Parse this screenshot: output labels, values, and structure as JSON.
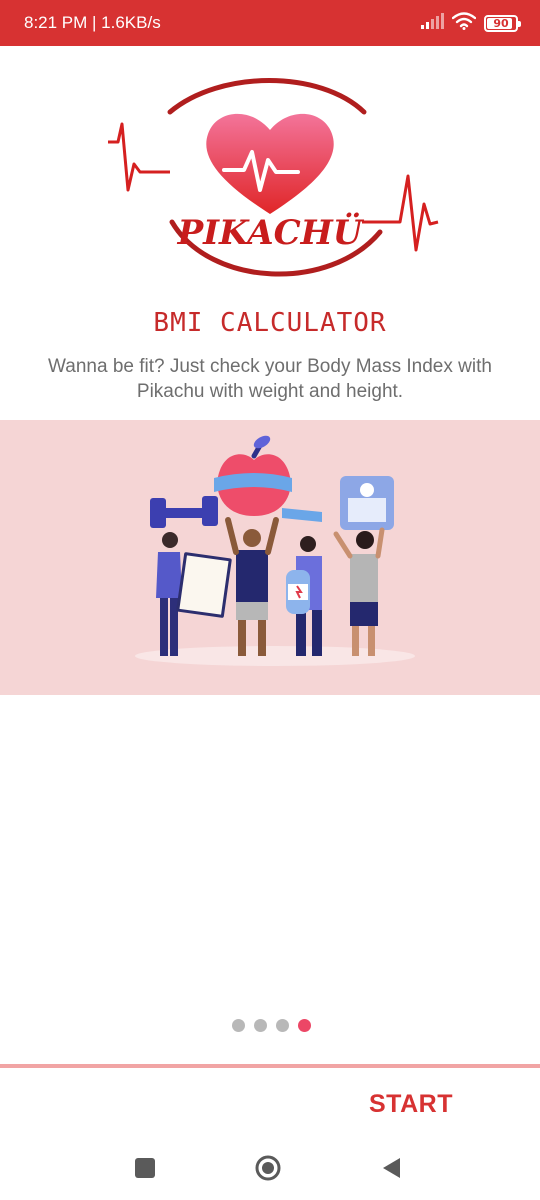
{
  "status_bar": {
    "time_speed": "8:21 PM | 1.6KB/s",
    "battery_level": "90",
    "icons": [
      "signal-icon",
      "wifi-icon",
      "battery-icon"
    ]
  },
  "logo": {
    "brand": "PIKACHÜ"
  },
  "app_title": "BMI CALCULATOR",
  "tagline": "Wanna be fit? Just check your Body Mass Index with Pikachu with weight and height.",
  "onboarding": {
    "page_count": 4,
    "active_page": 4
  },
  "start_button": {
    "label": "START"
  },
  "nav_bar": {
    "icons": [
      "recents-square-icon",
      "home-circle-icon",
      "back-triangle-icon"
    ]
  },
  "colors": {
    "accent": "#d73232",
    "banner_bg": "#f5d5d5",
    "active_dot": "#ec4766",
    "inactive_dot": "#b8b8b8"
  }
}
